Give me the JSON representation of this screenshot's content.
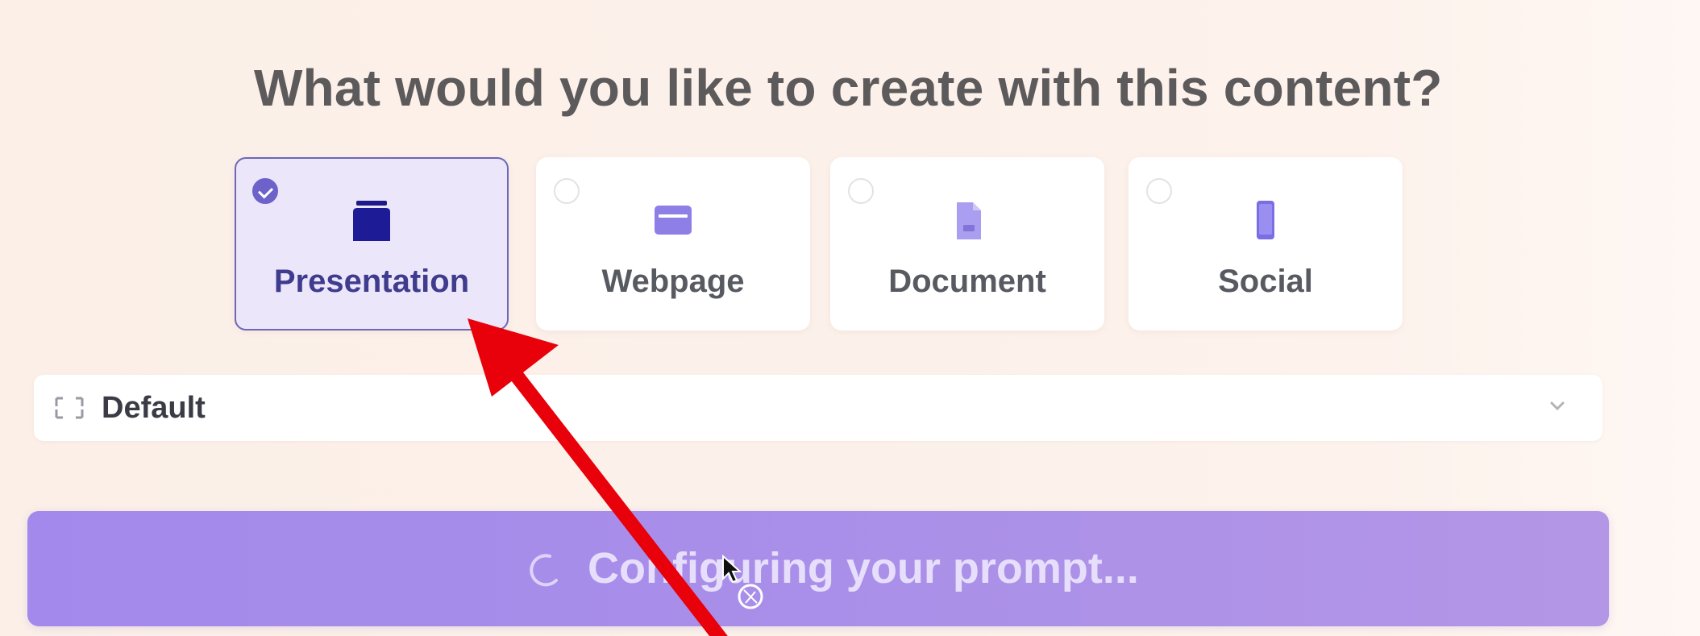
{
  "heading": "What would you like to create with this content?",
  "options": [
    {
      "label": "Presentation",
      "selected": true,
      "icon": "presentation-icon"
    },
    {
      "label": "Webpage",
      "selected": false,
      "icon": "webpage-icon"
    },
    {
      "label": "Document",
      "selected": false,
      "icon": "document-icon"
    },
    {
      "label": "Social",
      "selected": false,
      "icon": "social-icon"
    }
  ],
  "dropdown": {
    "value": "Default",
    "icon": "expand-icon"
  },
  "action_button": {
    "label": "Configuring your prompt...",
    "icon": "loading-spinner-icon"
  },
  "colors": {
    "accent": "#6c62c9",
    "selected_card_bg": "#ece6fb",
    "button_bg": "#a98fe9",
    "annotation_arrow": "#e8000b"
  }
}
